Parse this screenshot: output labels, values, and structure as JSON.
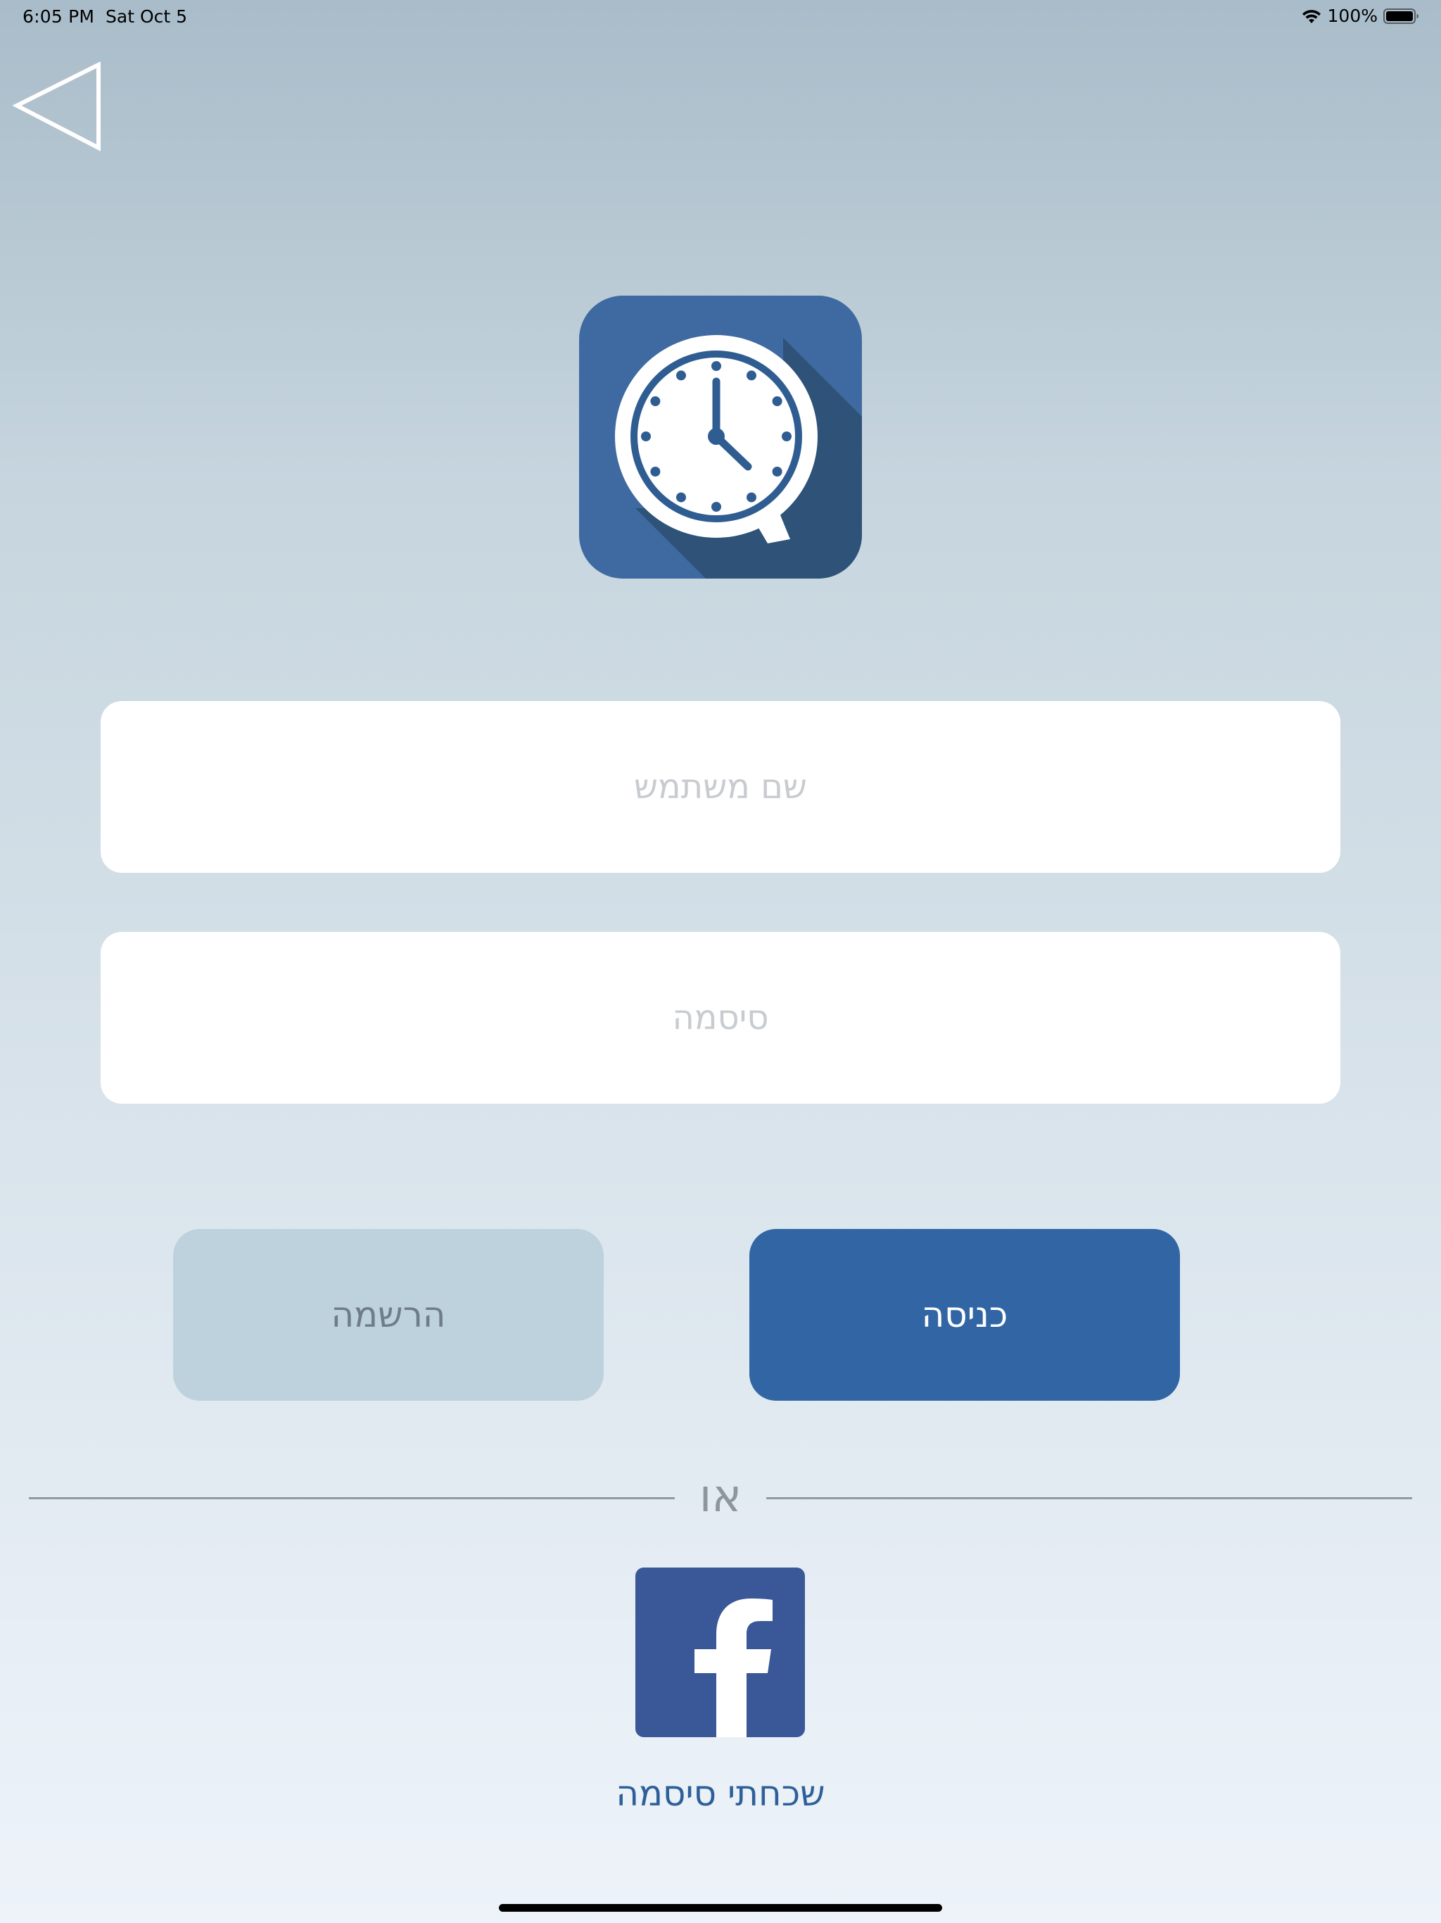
{
  "status_bar": {
    "time": "6:05 PM",
    "date": "Sat Oct 5",
    "battery_percent": "100%",
    "wifi_icon": "wifi-icon",
    "battery_icon": "battery-icon"
  },
  "back_icon": "back-triangle-icon",
  "logo_icon": "clock-app-logo",
  "login_form": {
    "username_placeholder": "שם משתמש",
    "username_value": "",
    "password_placeholder": "סיסמה",
    "password_value": ""
  },
  "buttons": {
    "register_label": "הרשמה",
    "login_label": "כניסה"
  },
  "divider_text": "או",
  "facebook_icon": "facebook-icon",
  "forgot_password_label": "שכחתי סיסמה",
  "colors": {
    "primary": "#3165a4",
    "secondary_button": "#bdd2dd",
    "facebook": "#3a5897",
    "logo_bg": "#3e6aa1"
  }
}
